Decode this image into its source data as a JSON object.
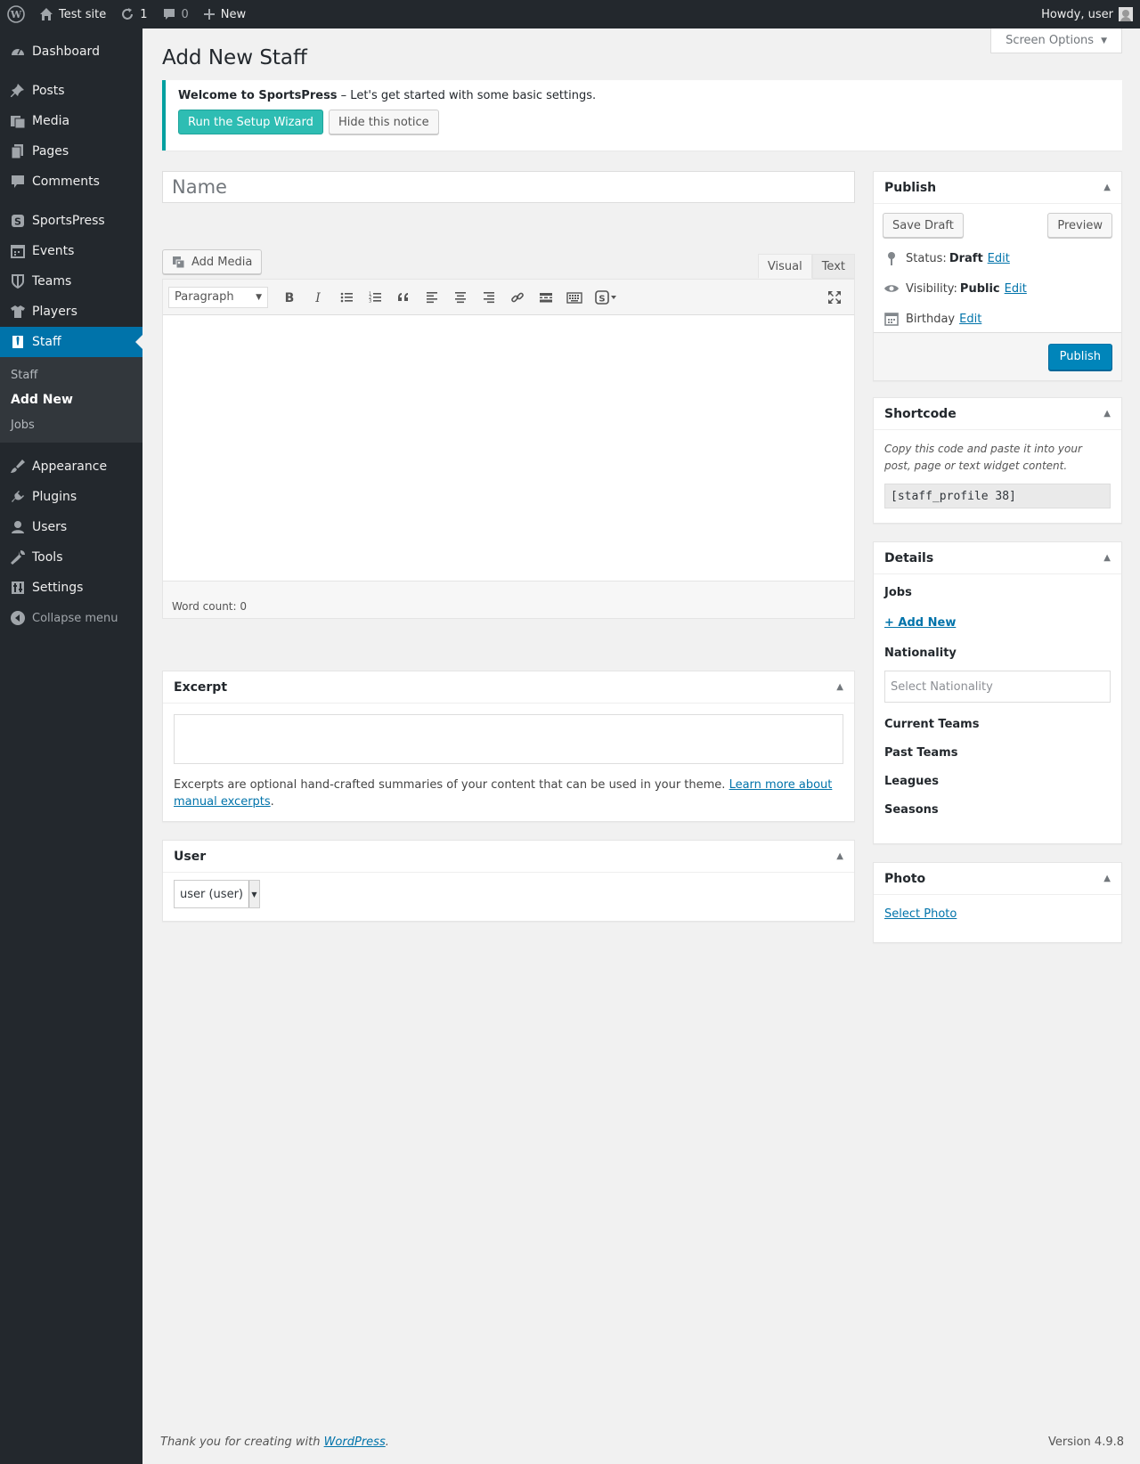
{
  "adminbar": {
    "site_name": "Test site",
    "updates_count": "1",
    "comments_count": "0",
    "new_label": "New",
    "howdy": "Howdy, user"
  },
  "sidebar": {
    "items": [
      {
        "label": "Dashboard",
        "icon": "dashboard-icon"
      },
      {
        "label": "Posts",
        "icon": "pin-icon"
      },
      {
        "label": "Media",
        "icon": "media-icon"
      },
      {
        "label": "Pages",
        "icon": "pages-icon"
      },
      {
        "label": "Comments",
        "icon": "comment-icon"
      },
      {
        "label": "SportsPress",
        "icon": "sportspress-icon"
      },
      {
        "label": "Events",
        "icon": "calendar-icon"
      },
      {
        "label": "Teams",
        "icon": "shield-icon"
      },
      {
        "label": "Players",
        "icon": "shirt-icon"
      },
      {
        "label": "Staff",
        "icon": "tie-icon"
      },
      {
        "label": "Appearance",
        "icon": "brush-icon"
      },
      {
        "label": "Plugins",
        "icon": "plugin-icon"
      },
      {
        "label": "Users",
        "icon": "user-icon"
      },
      {
        "label": "Tools",
        "icon": "wrench-icon"
      },
      {
        "label": "Settings",
        "icon": "settings-icon"
      },
      {
        "label": "Collapse menu",
        "icon": "collapse-icon"
      }
    ],
    "submenu": [
      "Staff",
      "Add New",
      "Jobs"
    ]
  },
  "screen_options": "Screen Options",
  "page_title": "Add New Staff",
  "notice": {
    "title": "Welcome to SportsPress",
    "text": " – Let's get started with some basic settings.",
    "wizard_button": "Run the Setup Wizard",
    "hide_button": "Hide this notice"
  },
  "title_placeholder": "Name",
  "editor": {
    "add_media": "Add Media",
    "tab_visual": "Visual",
    "tab_text": "Text",
    "format": "Paragraph",
    "word_count": "Word count: 0"
  },
  "excerpt": {
    "title": "Excerpt",
    "help": "Excerpts are optional hand-crafted summaries of your content that can be used in your theme.",
    "link": "Learn more about manual excerpts"
  },
  "user_box": {
    "title": "User",
    "selected": "user (user)"
  },
  "publish": {
    "title": "Publish",
    "save_draft": "Save Draft",
    "preview": "Preview",
    "status_label": "Status:",
    "status_value": "Draft",
    "visibility_label": "Visibility:",
    "visibility_value": "Public",
    "birthday_label": "Birthday",
    "edit": "Edit",
    "publish_button": "Publish"
  },
  "shortcode": {
    "title": "Shortcode",
    "help": "Copy this code and paste it into your post, page or text widget content.",
    "code": "[staff_profile 38]"
  },
  "details": {
    "title": "Details",
    "jobs": "Jobs",
    "add_new": "+ Add New",
    "nationality": "Nationality",
    "nationality_placeholder": "Select Nationality",
    "current_teams": "Current Teams",
    "past_teams": "Past Teams",
    "leagues": "Leagues",
    "seasons": "Seasons"
  },
  "photo": {
    "title": "Photo",
    "select": "Select Photo"
  },
  "footer": {
    "thanks": "Thank you for creating with ",
    "wp_link": "WordPress",
    "version": "Version 4.9.8"
  },
  "colors": {
    "admin_dark": "#23282d",
    "accent_blue": "#0073aa",
    "teal": "#2ebdb3"
  }
}
